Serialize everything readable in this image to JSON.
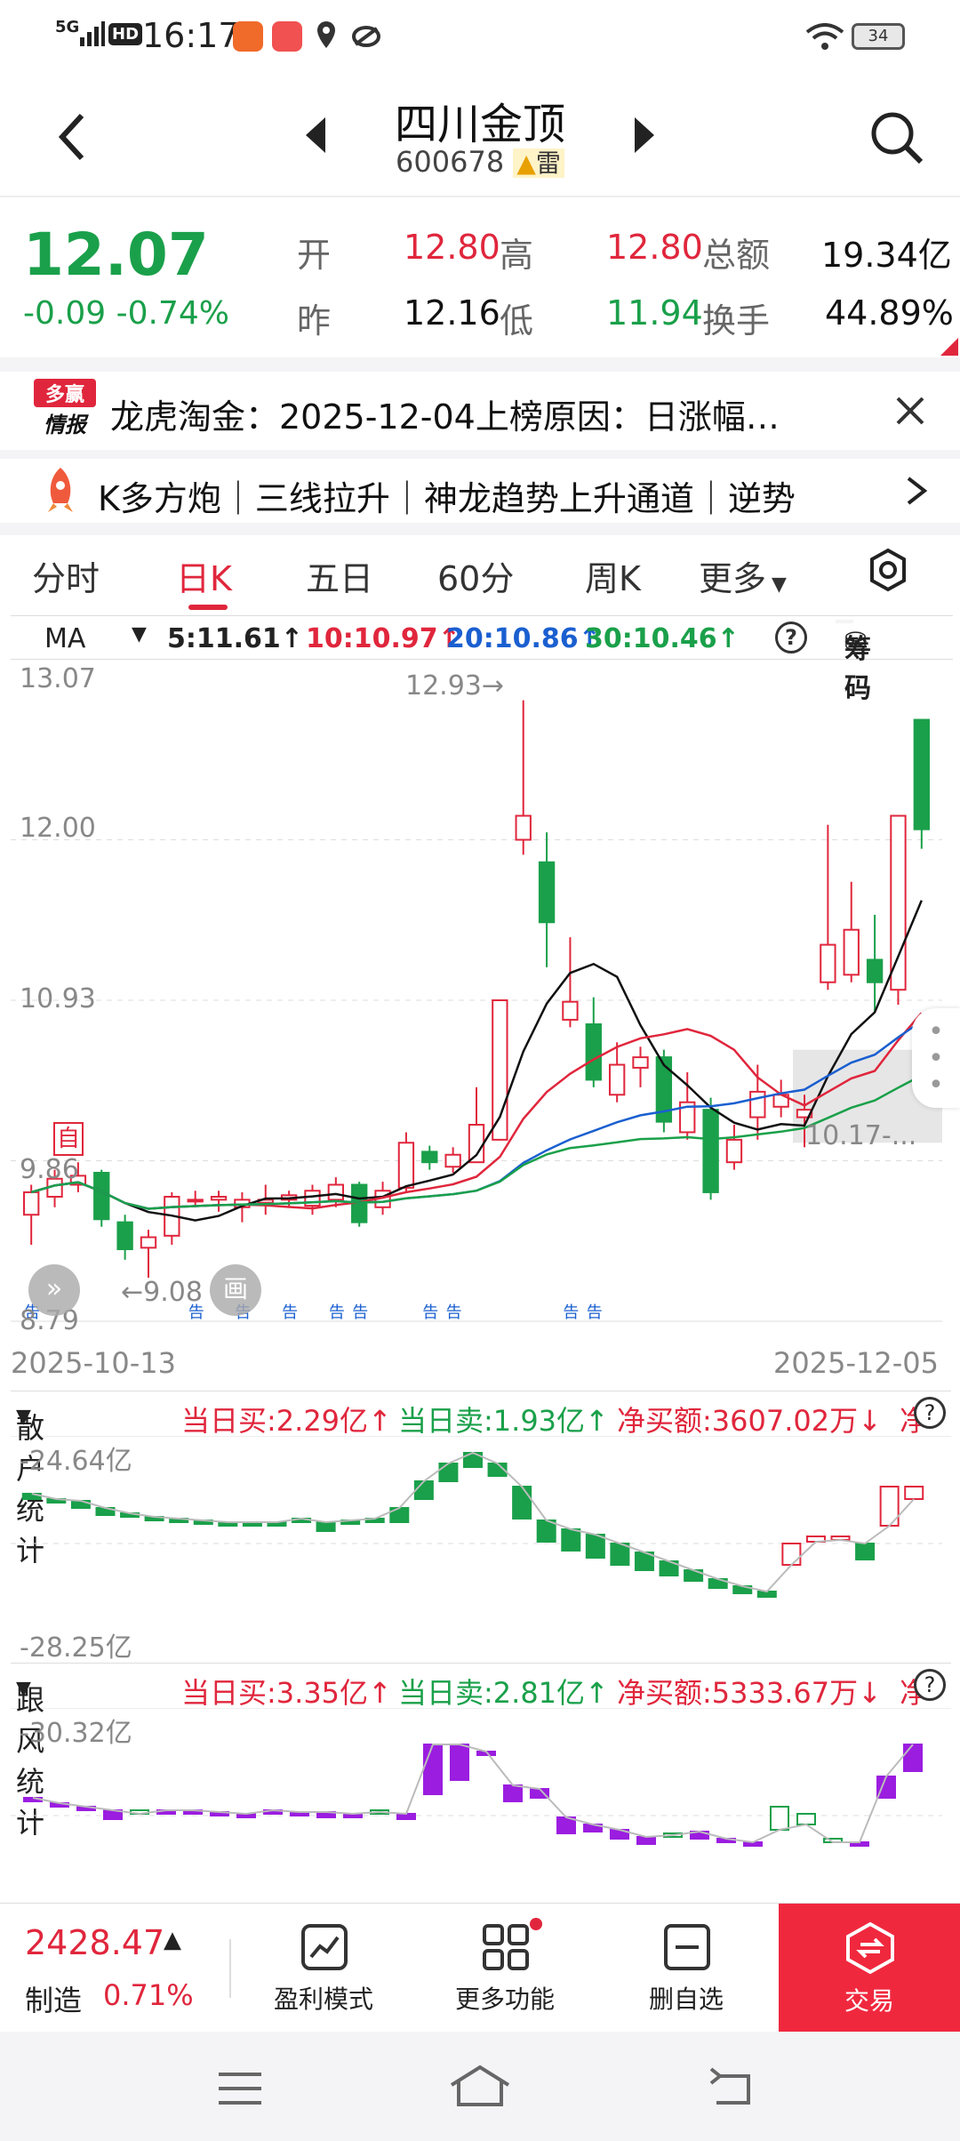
{
  "status": {
    "network": "5G",
    "hd": "HD",
    "time": "16:17",
    "battery": "34"
  },
  "header": {
    "name": "四川金顶",
    "code": "600678",
    "tag": "雷"
  },
  "quote": {
    "price": "12.07",
    "change": "-0.09",
    "change_pct": "-0.74%",
    "open_label": "开",
    "open": "12.80",
    "high_label": "高",
    "high": "12.80",
    "amount_label": "总额",
    "amount": "19.34亿",
    "prev_label": "昨",
    "prev": "12.16",
    "low_label": "低",
    "low": "11.94",
    "turnover_label": "换手",
    "turnover": "44.89%"
  },
  "news": {
    "badge_top": "多赢",
    "badge_bottom": "情报",
    "text": "龙虎淘金：2025-12-04上榜原因：日涨幅…"
  },
  "ticker": {
    "text": "K多方炮｜三线拉升｜神龙趋势上升通道｜逆势"
  },
  "tabs": [
    "分时",
    "日K",
    "五日",
    "60分",
    "周K",
    "更多"
  ],
  "ma": {
    "type": "MA",
    "ma5": "5:11.61↑",
    "ma10": "10:10.97↑",
    "ma20": "20:10.86↑",
    "ma30": "30:10.46↑",
    "chip": "筹码"
  },
  "kchart": {
    "y_labels": [
      "13.07",
      "12.00",
      "10.93",
      "9.86",
      "8.79"
    ],
    "max_label": "12.93",
    "min_label": "9.08",
    "range_label": "10.17-...",
    "self_tag": "自",
    "start_date": "2025-10-13",
    "end_date": "2025-12-05",
    "draw_button": "画"
  },
  "ind1": {
    "name": "散户统计",
    "buy": "当日买:2.29亿↑",
    "sell": "当日卖:1.93亿↑",
    "net": "净买额:3607.02万↓",
    "more": "净",
    "top": "-24.64亿",
    "bottom": "-28.25亿"
  },
  "ind2": {
    "name": "跟风统计",
    "buy": "当日买:3.35亿↑",
    "sell": "当日卖:2.81亿↑",
    "net": "净买额:5333.67万↓",
    "more": "净",
    "top": "-30.32亿"
  },
  "bottom": {
    "index_value": "2428.47",
    "index_name": "制造",
    "index_pct": "0.71%",
    "btn1": "盈利模式",
    "btn2": "更多功能",
    "btn3": "删自选",
    "btn4": "交易"
  },
  "chart_data": {
    "type": "candlestick",
    "x_start": "2025-10-13",
    "x_end": "2025-12-05",
    "ylim": [
      8.79,
      13.07
    ],
    "candles": [
      {
        "o": 9.5,
        "c": 9.65,
        "h": 9.7,
        "l": 9.3
      },
      {
        "o": 9.62,
        "c": 9.74,
        "h": 9.8,
        "l": 9.55
      },
      {
        "o": 9.7,
        "c": 9.76,
        "h": 9.85,
        "l": 9.65
      },
      {
        "o": 9.78,
        "c": 9.47,
        "h": 9.8,
        "l": 9.42
      },
      {
        "o": 9.45,
        "c": 9.27,
        "h": 9.5,
        "l": 9.2
      },
      {
        "o": 9.28,
        "c": 9.35,
        "h": 9.4,
        "l": 9.08
      },
      {
        "o": 9.36,
        "c": 9.62,
        "h": 9.65,
        "l": 9.3
      },
      {
        "o": 9.6,
        "c": 9.6,
        "h": 9.66,
        "l": 9.55
      },
      {
        "o": 9.6,
        "c": 9.62,
        "h": 9.66,
        "l": 9.52
      },
      {
        "o": 9.55,
        "c": 9.6,
        "h": 9.65,
        "l": 9.45
      },
      {
        "o": 9.58,
        "c": 9.6,
        "h": 9.7,
        "l": 9.5
      },
      {
        "o": 9.6,
        "c": 9.63,
        "h": 9.66,
        "l": 9.55
      },
      {
        "o": 9.56,
        "c": 9.66,
        "h": 9.7,
        "l": 9.5
      },
      {
        "o": 9.6,
        "c": 9.7,
        "h": 9.75,
        "l": 9.55
      },
      {
        "o": 9.7,
        "c": 9.45,
        "h": 9.72,
        "l": 9.42
      },
      {
        "o": 9.55,
        "c": 9.66,
        "h": 9.72,
        "l": 9.5
      },
      {
        "o": 9.68,
        "c": 9.98,
        "h": 10.05,
        "l": 9.65
      },
      {
        "o": 9.92,
        "c": 9.85,
        "h": 9.96,
        "l": 9.8
      },
      {
        "o": 9.82,
        "c": 9.9,
        "h": 9.95,
        "l": 9.78
      },
      {
        "o": 9.85,
        "c": 10.1,
        "h": 10.35,
        "l": 9.85
      },
      {
        "o": 10.0,
        "c": 10.93,
        "h": 10.93,
        "l": 10.0
      },
      {
        "o": 12.0,
        "c": 12.16,
        "h": 12.93,
        "l": 11.9
      },
      {
        "o": 11.85,
        "c": 11.45,
        "h": 12.05,
        "l": 11.15
      },
      {
        "o": 10.8,
        "c": 10.92,
        "h": 11.35,
        "l": 10.75
      },
      {
        "o": 10.77,
        "c": 10.4,
        "h": 10.95,
        "l": 10.35
      },
      {
        "o": 10.3,
        "c": 10.5,
        "h": 10.65,
        "l": 10.25
      },
      {
        "o": 10.48,
        "c": 10.55,
        "h": 10.62,
        "l": 10.35
      },
      {
        "o": 10.55,
        "c": 10.12,
        "h": 10.6,
        "l": 10.05
      },
      {
        "o": 10.05,
        "c": 10.25,
        "h": 10.45,
        "l": 10.0
      },
      {
        "o": 10.2,
        "c": 9.65,
        "h": 10.28,
        "l": 9.6
      },
      {
        "o": 9.85,
        "c": 10.0,
        "h": 10.1,
        "l": 9.8
      },
      {
        "o": 10.15,
        "c": 10.32,
        "h": 10.5,
        "l": 10.0
      },
      {
        "o": 10.22,
        "c": 10.3,
        "h": 10.4,
        "l": 10.15
      },
      {
        "o": 10.15,
        "c": 10.2,
        "h": 10.3,
        "l": 9.95
      },
      {
        "o": 11.05,
        "c": 11.3,
        "h": 12.1,
        "l": 11.0
      },
      {
        "o": 11.1,
        "c": 11.4,
        "h": 11.72,
        "l": 11.05
      },
      {
        "o": 11.2,
        "c": 11.05,
        "h": 11.5,
        "l": 10.85
      },
      {
        "o": 11.0,
        "c": 12.16,
        "h": 12.16,
        "l": 10.9
      },
      {
        "o": 12.8,
        "c": 12.07,
        "h": 12.8,
        "l": 11.94
      }
    ]
  }
}
